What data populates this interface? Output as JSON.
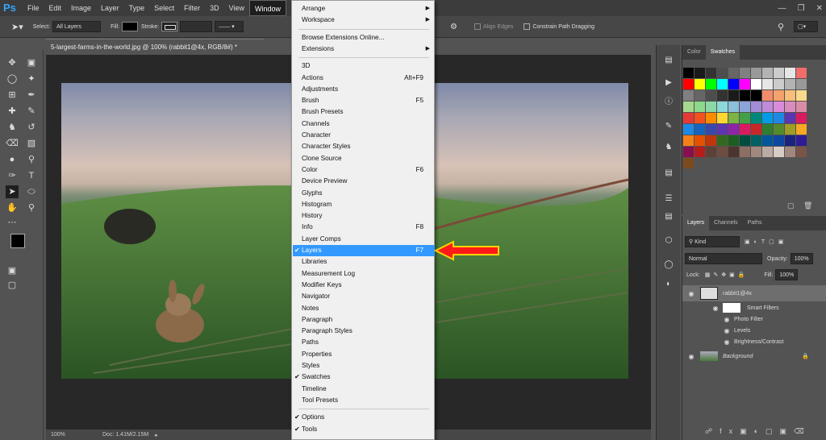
{
  "app_logo": "Ps",
  "menubar": [
    "File",
    "Edit",
    "Image",
    "Layer",
    "Type",
    "Select",
    "Filter",
    "3D",
    "View",
    "Window"
  ],
  "active_menu": "Window",
  "options_bar": {
    "select_label": "Select:",
    "select_value": "All Layers",
    "fill_label": "Fill:",
    "stroke_label": "Stroke:",
    "align_edges": "Align Edges",
    "constrain": "Constrain Path Dragging"
  },
  "document": {
    "tab_title": "5-largest-farms-in-the-world.jpg @ 100% (rabbit1@4x, RGB/8#) *",
    "zoom": "100%",
    "doc_size": "Doc: 1.41M/2.15M"
  },
  "window_menu": [
    {
      "label": "Arrange",
      "submenu": true
    },
    {
      "label": "Workspace",
      "submenu": true
    },
    {
      "sep": true
    },
    {
      "label": "Browse Extensions Online..."
    },
    {
      "label": "Extensions",
      "submenu": true
    },
    {
      "sep": true
    },
    {
      "label": "3D"
    },
    {
      "label": "Actions",
      "shortcut": "Alt+F9"
    },
    {
      "label": "Adjustments"
    },
    {
      "label": "Brush",
      "shortcut": "F5"
    },
    {
      "label": "Brush Presets"
    },
    {
      "label": "Channels"
    },
    {
      "label": "Character"
    },
    {
      "label": "Character Styles"
    },
    {
      "label": "Clone Source"
    },
    {
      "label": "Color",
      "shortcut": "F6"
    },
    {
      "label": "Device Preview"
    },
    {
      "label": "Glyphs"
    },
    {
      "label": "Histogram"
    },
    {
      "label": "History"
    },
    {
      "label": "Info",
      "shortcut": "F8"
    },
    {
      "label": "Layer Comps"
    },
    {
      "label": "Layers",
      "shortcut": "F7",
      "checked": true,
      "highlighted": true
    },
    {
      "label": "Libraries"
    },
    {
      "label": "Measurement Log"
    },
    {
      "label": "Modifier Keys"
    },
    {
      "label": "Navigator"
    },
    {
      "label": "Notes"
    },
    {
      "label": "Paragraph"
    },
    {
      "label": "Paragraph Styles"
    },
    {
      "label": "Paths"
    },
    {
      "label": "Properties"
    },
    {
      "label": "Styles"
    },
    {
      "label": "Swatches",
      "checked": true
    },
    {
      "label": "Timeline"
    },
    {
      "label": "Tool Presets"
    },
    {
      "sep": true
    },
    {
      "label": "Options",
      "checked": true
    },
    {
      "label": "Tools",
      "checked": true
    }
  ],
  "swatch_panel": {
    "tabs": [
      "Color",
      "Swatches"
    ],
    "colors": [
      "#000000",
      "#1a1a1a",
      "#333333",
      "#4d4d4d",
      "#666666",
      "#808080",
      "#999999",
      "#b3b3b3",
      "#cccccc",
      "#e6e6e6",
      "#f26c6c",
      "#ff0000",
      "#ffff00",
      "#00ff00",
      "#00ffff",
      "#0000ff",
      "#ff00ff",
      "#ffffff",
      "#e6e6e6",
      "#cccccc",
      "#b3b3b3",
      "#999999",
      "#808080",
      "#666666",
      "#4d4d4d",
      "#333333",
      "#1a1a1a",
      "#000000",
      "#000000",
      "#f28c6c",
      "#f5a26c",
      "#f7bf7a",
      "#fbd98c",
      "#a5d98c",
      "#8cd98c",
      "#8cd9a5",
      "#8cd9d9",
      "#8cbfd9",
      "#8ca5d9",
      "#a58cd9",
      "#bf8cd9",
      "#d98cd9",
      "#d98cbf",
      "#d98ca5",
      "#e53935",
      "#f4511e",
      "#fb8c00",
      "#fdd835",
      "#7cb342",
      "#43a047",
      "#00897b",
      "#039be5",
      "#1e88e5",
      "#5e35b1",
      "#d81b60",
      "#1e88e5",
      "#1565c0",
      "#3949ab",
      "#5e35b1",
      "#8e24aa",
      "#d81b60",
      "#c62828",
      "#2e7d32",
      "#558b2f",
      "#9e9d24",
      "#f9a825",
      "#f57f17",
      "#e65100",
      "#bf360c",
      "#33691e",
      "#1b5e20",
      "#004d40",
      "#006064",
      "#01579b",
      "#0d47a1",
      "#1a237e",
      "#311b92",
      "#880e4f",
      "#b71c1c",
      "#5d4037",
      "#6d4c41",
      "#4e342e",
      "#8d6e63",
      "#a1887f",
      "#bcaaa4",
      "#d7ccc8",
      "#a1887f",
      "#795548",
      "#7b4a1e"
    ]
  },
  "layers_panel": {
    "tabs": [
      "Layers",
      "Channels",
      "Paths"
    ],
    "kind": "Kind",
    "blend": "Normal",
    "opacity_label": "Opacity:",
    "opacity": "100%",
    "lock_label": "Lock:",
    "fill_label": "Fill:",
    "fill": "100%",
    "layers": [
      {
        "name": "rabbit1@4x"
      },
      {
        "name": "Smart Filters"
      },
      {
        "name": "Photo Filter"
      },
      {
        "name": "Levels"
      },
      {
        "name": "Brightness/Contrast"
      },
      {
        "name": "Background"
      }
    ]
  }
}
